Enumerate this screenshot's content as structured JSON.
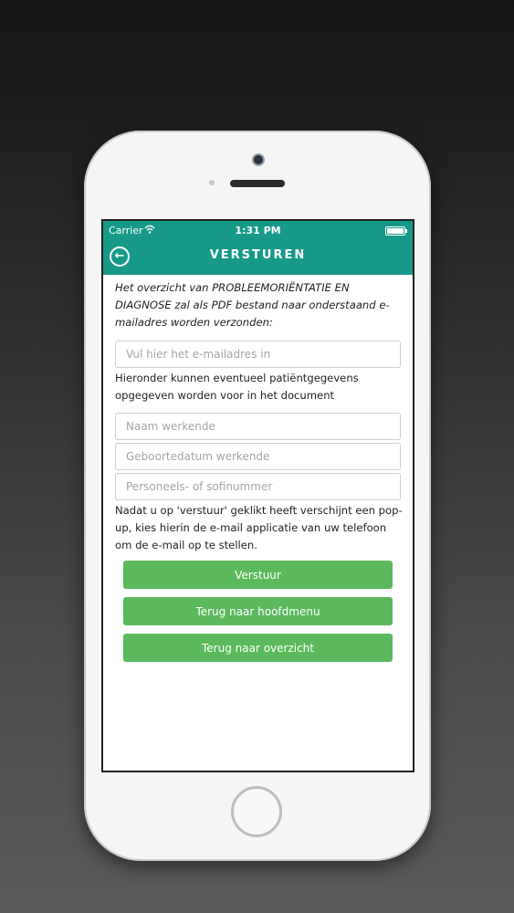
{
  "status_bar": {
    "carrier": "Carrier",
    "time": "1:31 PM"
  },
  "header": {
    "title": "VERSTUREN",
    "back_icon": "arrow-left-circle-icon"
  },
  "intro_text": "Het overzicht van PROBLEEMORIËNTATIE EN DIAGNOSE zal als PDF bestand naar onderstaand e-mailadres worden verzonden:",
  "email_field": {
    "placeholder": "Vul hier het e-mailadres in"
  },
  "patient_info_text": "Hieronder kunnen eventueel patiëntgegevens opgegeven worden voor in het document",
  "name_field": {
    "placeholder": "Naam werkende"
  },
  "dob_field": {
    "placeholder": "Geboortedatum werkende"
  },
  "id_field": {
    "placeholder": "Personeels- of sofinummer"
  },
  "popup_text": "Nadat u op 'verstuur' geklikt heeft verschijnt een pop-up, kies hierin de e-mail applicatie van uw telefoon om de e-mail op te stellen.",
  "buttons": {
    "send": "Verstuur",
    "main_menu": "Terug naar hoofdmenu",
    "overview": "Terug naar overzicht"
  },
  "colors": {
    "header": "#17998a",
    "button": "#5cb85c"
  }
}
